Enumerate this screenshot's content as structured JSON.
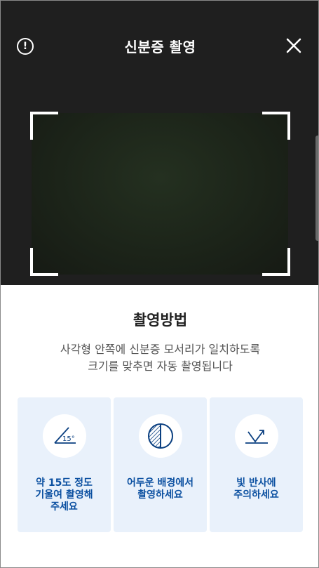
{
  "header": {
    "title": "신분증 촬영",
    "info_icon": "info-icon",
    "close_icon": "close-icon"
  },
  "guide": {
    "title": "촬영방법",
    "description_line1": "사각형 안쪽에 신분증 모서리가 일치하도록",
    "description_line2": "크기를 맞추면 자동 촬영됩니다"
  },
  "tips": [
    {
      "icon": "tilt-angle-icon",
      "angle_label": "15°",
      "text": "약 15도 정도\n기울여 촬영해\n주세요"
    },
    {
      "icon": "contrast-icon",
      "text": "어두운 배경에서\n촬영하세요"
    },
    {
      "icon": "reflection-icon",
      "text": "빛 반사에\n주의하세요"
    }
  ],
  "colors": {
    "camera_bg": "#1f1f1f",
    "card_bg": "#e9f1fb",
    "tip_text": "#0a4fa0"
  }
}
